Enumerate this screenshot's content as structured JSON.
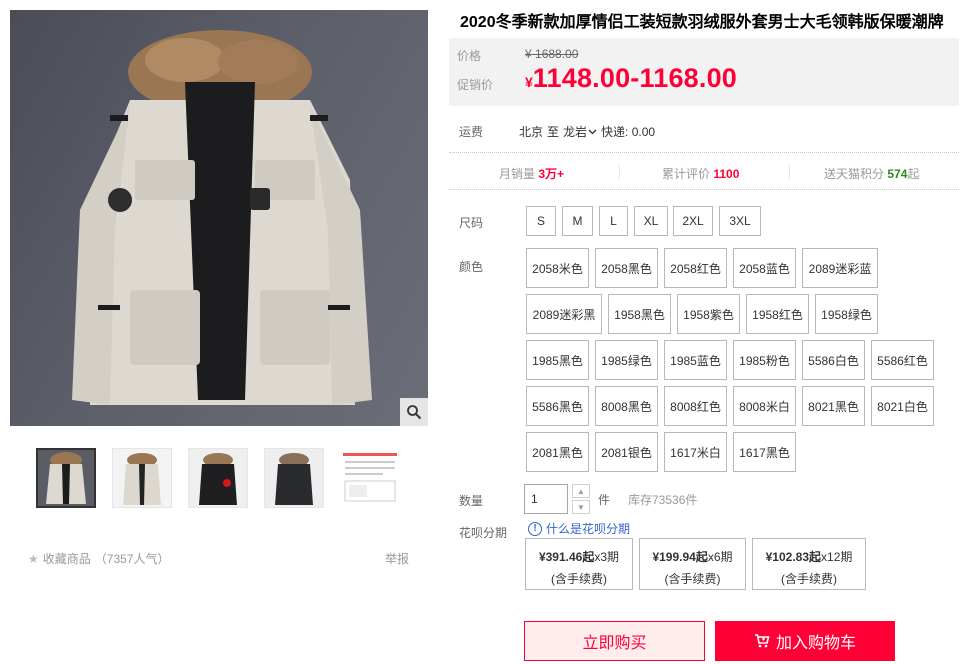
{
  "product": {
    "title": "2020冬季新款加厚情侣工装短款羽绒服外套男士大毛领韩版保暖潮牌"
  },
  "price": {
    "original_label": "价格",
    "original_currency": "¥",
    "original_value": "1688.00",
    "promo_label": "促销价",
    "promo_currency": "¥",
    "promo_value": "1148.00-1168.00"
  },
  "shipping": {
    "label": "运费",
    "from": "北京",
    "to_word": "至",
    "to": "龙岩",
    "express": "快递: 0.00"
  },
  "stats": {
    "monthly_label": "月销量",
    "monthly_value": "3万+",
    "reviews_label": "累计评价",
    "reviews_value": "1100",
    "points_label": "送天猫积分",
    "points_value": "574",
    "points_suffix": "起"
  },
  "size": {
    "label": "尺码",
    "options": [
      "S",
      "M",
      "L",
      "XL",
      "2XL",
      "3XL"
    ]
  },
  "color": {
    "label": "颜色",
    "options": [
      "2058米色",
      "2058黑色",
      "2058红色",
      "2058蓝色",
      "2089迷彩蓝",
      "2089迷彩黑",
      "1958黑色",
      "1958紫色",
      "1958红色",
      "1958绿色",
      "1985黑色",
      "1985绿色",
      "1985蓝色",
      "1985粉色",
      "5586白色",
      "5586红色",
      "5586黑色",
      "8008黑色",
      "8008红色",
      "8008米白",
      "8021黑色",
      "8021白色",
      "2081黑色",
      "2081银色",
      "1617米白",
      "1617黑色"
    ]
  },
  "quantity": {
    "label": "数量",
    "value": "1",
    "unit": "件",
    "stock": "库存73536件"
  },
  "installment": {
    "label": "花呗分期",
    "link": "什么是花呗分期",
    "plans": [
      {
        "amount": "¥391.46起",
        "periods": "x3期",
        "fee": "(含手续费)"
      },
      {
        "amount": "¥199.94起",
        "periods": "x6期",
        "fee": "(含手续费)"
      },
      {
        "amount": "¥102.83起",
        "periods": "x12期",
        "fee": "(含手续费)"
      }
    ]
  },
  "actions": {
    "buy_now": "立即购买",
    "add_to_cart": "加入购物车"
  },
  "gallery": {
    "collect_label": "收藏商品",
    "collect_count": "（7357人气）",
    "report_label": "举报"
  },
  "colors": {
    "accent": "#ff0036",
    "link": "#3366cc",
    "points": "#2c8a20"
  }
}
